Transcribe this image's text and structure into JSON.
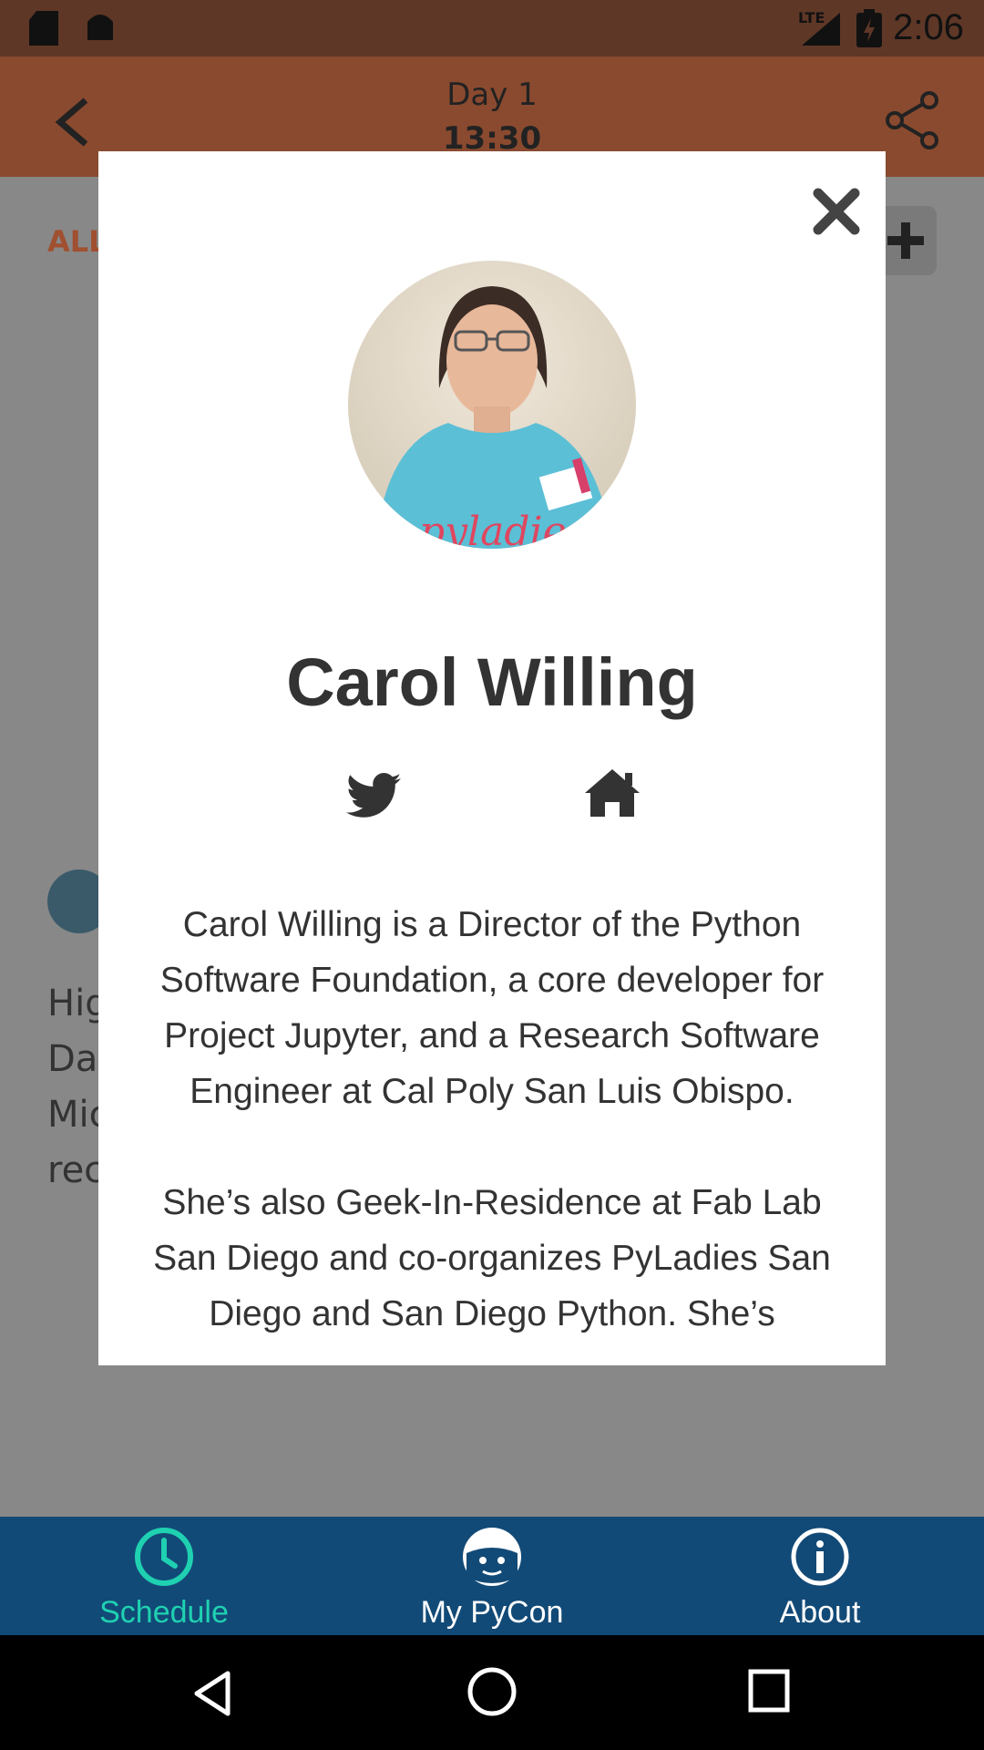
{
  "status_bar": {
    "network": "LTE",
    "time": "2:06"
  },
  "app_bar": {
    "day": "Day 1",
    "time": "13:30"
  },
  "background": {
    "tab_label": "ALL",
    "text_fragments": [
      "Hig",
      "Dat",
      "Mic",
      "rec"
    ]
  },
  "modal": {
    "speaker_name": "Carol Willing",
    "bio_paragraphs": [
      "Carol Willing is a Director of the Python Software Foundation, a core developer for Project Jupyter, and a Research Software Engineer at Cal Poly San Luis Obispo.",
      "She’s also Geek-In-Residence at Fab Lab San Diego and co-organizes PyLadies San Diego and San Diego Python. She’s"
    ],
    "icons": [
      "close-icon",
      "twitter-icon",
      "home-icon"
    ]
  },
  "bottom_nav": {
    "items": [
      {
        "label": "Schedule",
        "icon": "clock-icon",
        "active": true
      },
      {
        "label": "My PyCon",
        "icon": "face-icon",
        "active": false
      },
      {
        "label": "About",
        "icon": "info-icon",
        "active": false
      }
    ],
    "active_color": "#1fd1b1",
    "inactive_color": "#ffffff",
    "bar_color": "#124a77"
  },
  "colors": {
    "status_bar": "#5e3727",
    "app_bar": "#8a4a2f",
    "overlay": "#888888"
  }
}
